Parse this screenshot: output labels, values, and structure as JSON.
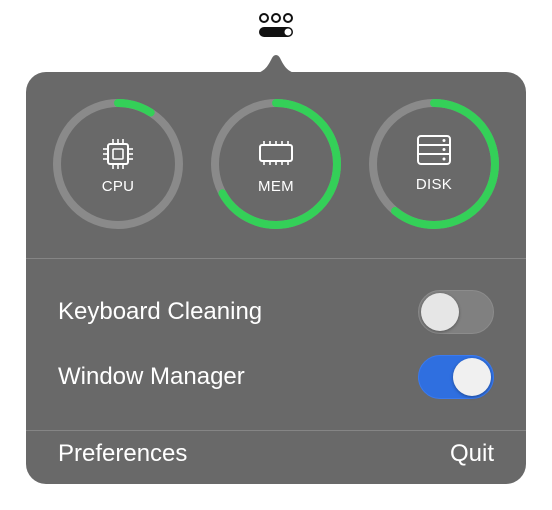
{
  "menubar": {
    "icon": "toggle-dots-icon"
  },
  "gauges": [
    {
      "label": "CPU",
      "icon": "cpu-chip-icon",
      "usage": 0.09
    },
    {
      "label": "MEM",
      "icon": "memory-module-icon",
      "usage": 0.67
    },
    {
      "label": "DISK",
      "icon": "disk-drive-icon",
      "usage": 0.61
    }
  ],
  "colors": {
    "popover_bg": "#696969",
    "ring_track": "#8a8a8a",
    "ring_fill": "#34d058",
    "toggle_on": "#2f6fe0",
    "toggle_off": "#808080"
  },
  "settings": {
    "keyboard_cleaning": {
      "label": "Keyboard Cleaning",
      "enabled": false
    },
    "window_manager": {
      "label": "Window Manager",
      "enabled": true
    }
  },
  "footer": {
    "preferences_label": "Preferences",
    "quit_label": "Quit"
  }
}
